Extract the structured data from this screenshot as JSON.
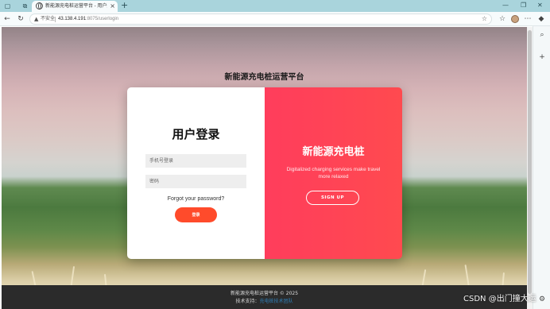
{
  "browser": {
    "tab_title": "新能源充电桩运营平台 - 用户登录",
    "tab_close": "×",
    "new_tab": "+",
    "not_secure": "不安全",
    "url_host": "43.138.4.191",
    "url_path": ":8075/userlogin",
    "icons": [
      "sidebar-icon",
      "workspaces-icon",
      "back-icon",
      "refresh-icon",
      "star-icon",
      "favorites-icon",
      "profile-icon",
      "more-icon",
      "search-icon",
      "add-icon",
      "settings-icon"
    ]
  },
  "page": {
    "heading": "新能源充电桩运营平台",
    "login": {
      "title": "用户登录",
      "phone_placeholder": "手机号登录",
      "password_placeholder": "密码",
      "forgot": "Forgot your password?",
      "button": "登录"
    },
    "brand": {
      "title": "新能源充电桩",
      "text": "Digitalized charging services make travel more relaxed",
      "signup": "SIGN UP"
    },
    "footer": {
      "copyright": "新能源充电桩运营平台 © 2025",
      "tech_label": "技术支持：",
      "tech_link": "充电桩技术团队"
    }
  },
  "watermark": "CSDN @出门撞大运",
  "colors": {
    "tabbar": "#a9d4dc",
    "panel_gradient_start": "#ff3d5c",
    "panel_gradient_end": "#ff4a4f",
    "login_button": "#ff4b2b",
    "footer": "#2b2b2b"
  }
}
